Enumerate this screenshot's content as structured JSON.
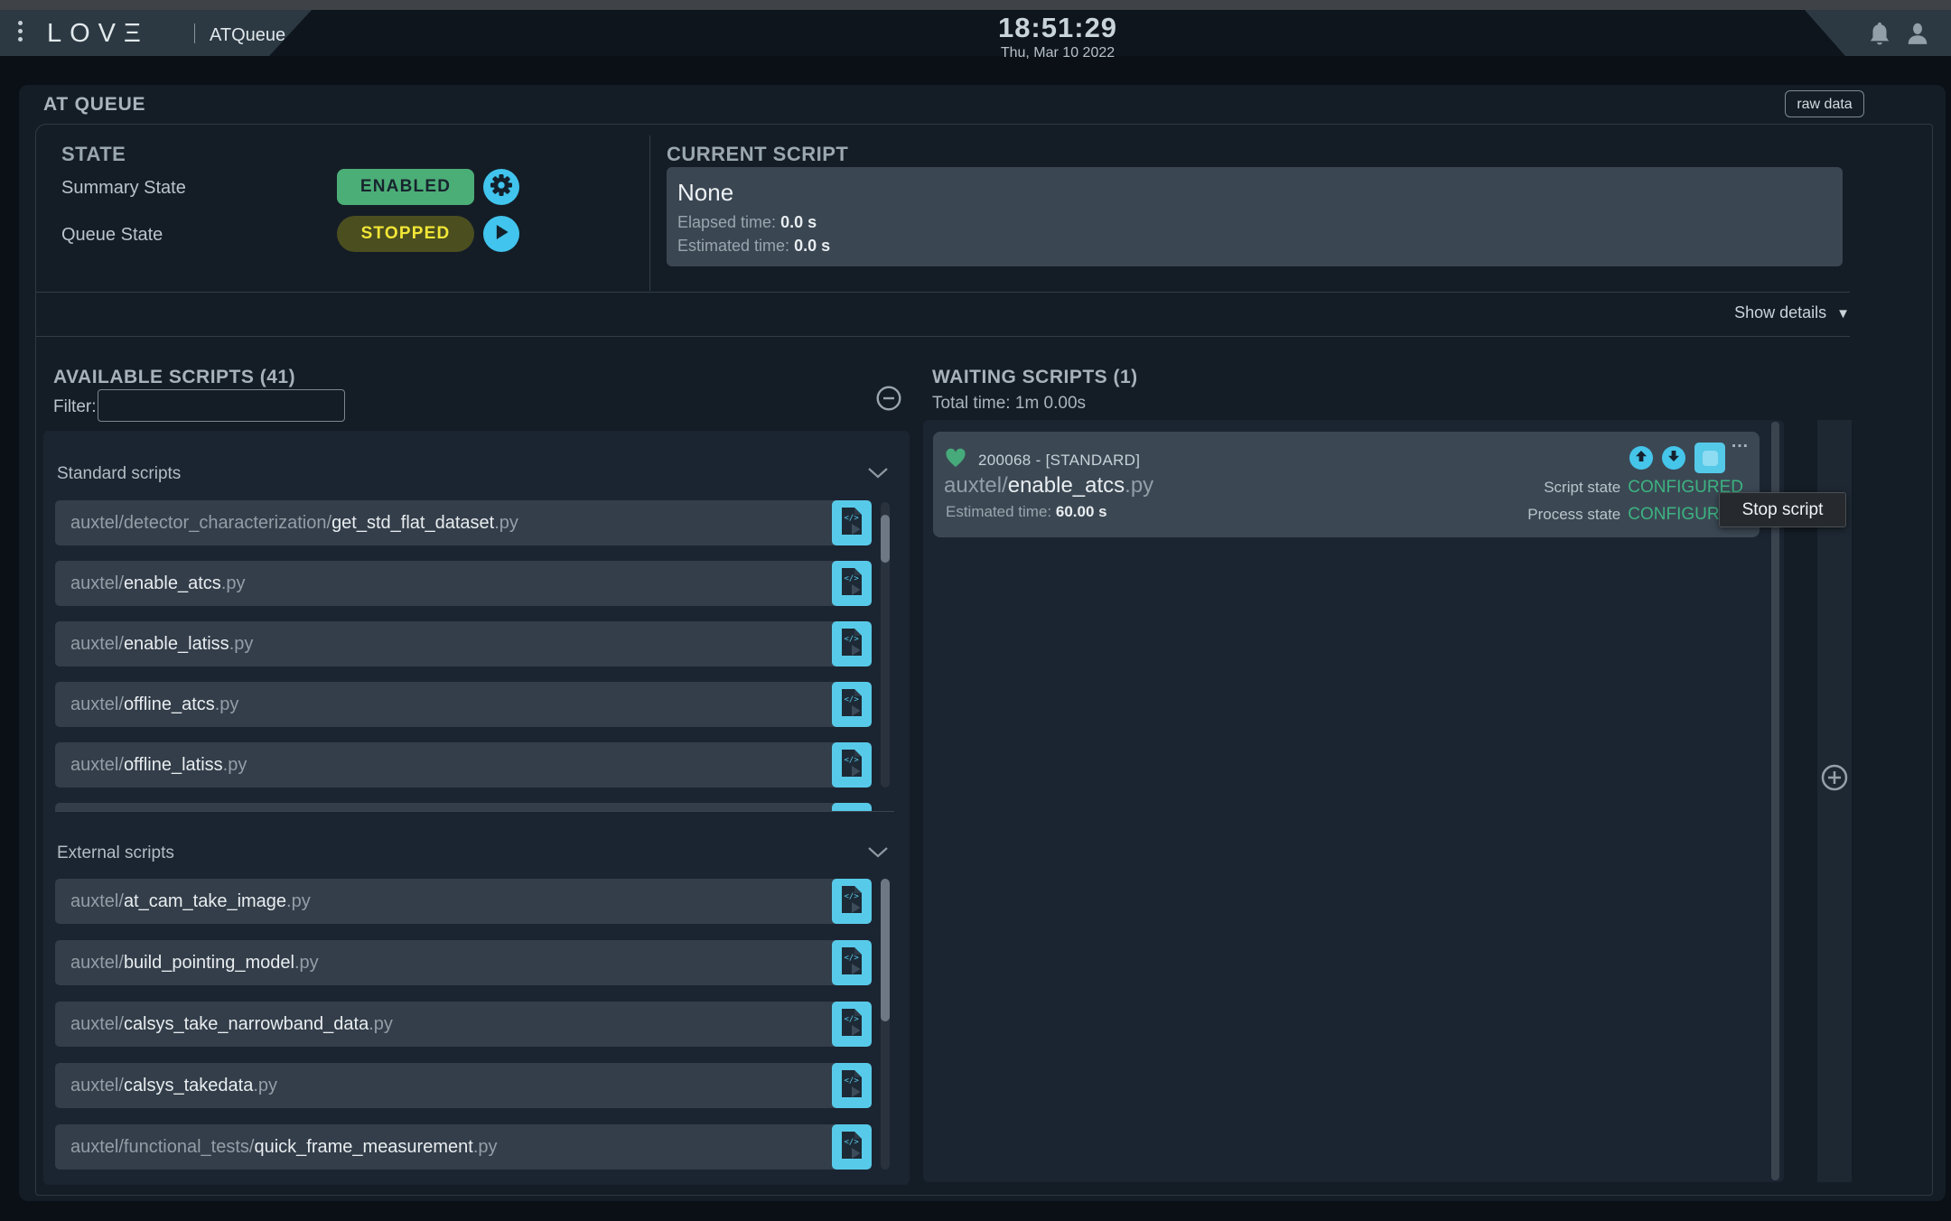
{
  "header": {
    "logo_text": "LOV",
    "logo_e": "Ξ",
    "app_name": "ATQueue",
    "time": "18:51:29",
    "date": "Thu, Mar 10 2022"
  },
  "toolbar": {
    "title": "AT QUEUE",
    "raw_data_label": "raw data"
  },
  "state": {
    "heading": "STATE",
    "summary_label": "Summary State",
    "summary_value": "ENABLED",
    "queue_label": "Queue State",
    "queue_value": "STOPPED"
  },
  "current_script": {
    "heading": "CURRENT SCRIPT",
    "name": "None",
    "elapsed_label": "Elapsed time:",
    "elapsed_value": "0.0 s",
    "estimated_label": "Estimated time:",
    "estimated_value": "0.0 s"
  },
  "show_details": {
    "label": "Show details",
    "icon": "▼"
  },
  "available": {
    "heading": "AVAILABLE SCRIPTS (41)",
    "filter_label": "Filter:",
    "filter_value": "",
    "standard_header": "Standard scripts",
    "external_header": "External scripts",
    "standard_scripts": [
      {
        "path": "auxtel/detector_characterization/",
        "name": "get_std_flat_dataset",
        "ext": ".py"
      },
      {
        "path": "auxtel/",
        "name": "enable_atcs",
        "ext": ".py"
      },
      {
        "path": "auxtel/",
        "name": "enable_latiss",
        "ext": ".py"
      },
      {
        "path": "auxtel/",
        "name": "offline_atcs",
        "ext": ".py"
      },
      {
        "path": "auxtel/",
        "name": "offline_latiss",
        "ext": ".py"
      }
    ],
    "external_scripts": [
      {
        "path": "auxtel/",
        "name": "at_cam_take_image",
        "ext": ".py"
      },
      {
        "path": "auxtel/",
        "name": "build_pointing_model",
        "ext": ".py"
      },
      {
        "path": "auxtel/",
        "name": "calsys_take_narrowband_data",
        "ext": ".py"
      },
      {
        "path": "auxtel/",
        "name": "calsys_takedata",
        "ext": ".py"
      },
      {
        "path": "auxtel/functional_tests/",
        "name": "quick_frame_measurement",
        "ext": ".py"
      }
    ]
  },
  "waiting": {
    "heading": "WAITING SCRIPTS (1)",
    "total_label": "Total time:",
    "total_value": "1m 0.00s",
    "card": {
      "id": "200068",
      "separator": "-",
      "type": "[STANDARD]",
      "path": "auxtel/",
      "name": "enable_atcs",
      "ext": ".py",
      "estimated_label": "Estimated time:",
      "estimated_value": "60.00 s",
      "script_state_label": "Script state",
      "script_state_value": "CONFIGURED",
      "process_state_label": "Process state",
      "process_state_value": "CONFIGURED"
    }
  },
  "tooltip": {
    "label": "Stop script"
  },
  "colors": {
    "accent_cyan": "#55c9e8",
    "enabled_green": "#4cae77",
    "stopped_yellow": "#f2e636",
    "configured_green": "#3db381",
    "heart_green": "#47aa7b"
  }
}
